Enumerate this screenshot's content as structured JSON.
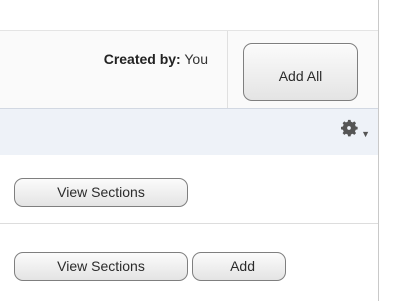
{
  "header": {
    "created_by_label": "Created by:",
    "created_by_value": "You",
    "add_all_label": "Add All"
  },
  "toolbar": {
    "settings_icon": "gear-icon"
  },
  "rows": [
    {
      "view_sections_label": "View Sections"
    },
    {
      "view_sections_label": "View Sections",
      "add_label": "Add"
    }
  ],
  "colors": {
    "toolbar_bg": "#eef2f8",
    "header_bg": "#fafafa",
    "button_border": "#7f7f7f"
  }
}
